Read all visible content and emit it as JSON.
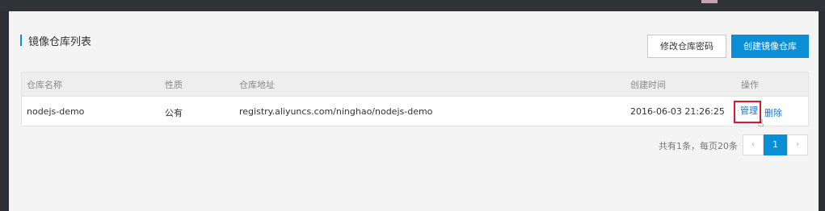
{
  "page": {
    "title": "镜像仓库列表",
    "accent_color": "#0a8fd6"
  },
  "toolbar": {
    "change_password_label": "修改仓库密码",
    "create_repo_label": "创建镜像仓库"
  },
  "table": {
    "headers": [
      "仓库名称",
      "性质",
      "仓库地址",
      "创建时间",
      "操作"
    ],
    "rows": [
      {
        "name": "nodejs-demo",
        "type": "公有",
        "address": "registry.aliyuncs.com/ninghao/nodejs-demo",
        "created": "2016-06-03 21:26:25",
        "actions": [
          "管理",
          "删除"
        ]
      }
    ]
  },
  "pagination": {
    "summary": "共有1条，每页20条",
    "prev_icon": "chevron-left-icon",
    "prev_glyph": "‹",
    "current_page": "1",
    "next_icon": "chevron-right-icon",
    "next_glyph": "›"
  }
}
